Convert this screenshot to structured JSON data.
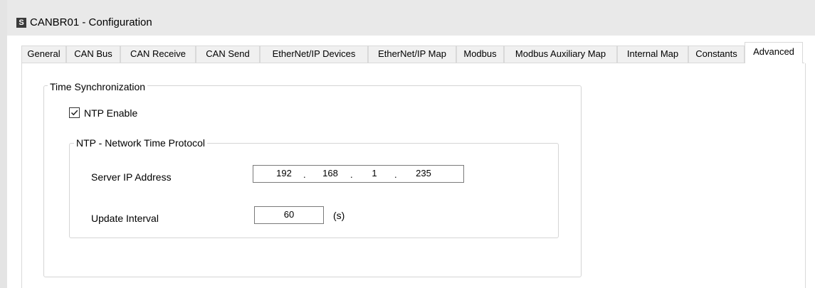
{
  "window": {
    "title": "CANBR01 - Configuration",
    "icon_letter": "S"
  },
  "tabs": [
    {
      "label": "General",
      "active": false
    },
    {
      "label": "CAN Bus",
      "active": false
    },
    {
      "label": "CAN Receive",
      "active": false
    },
    {
      "label": "CAN Send",
      "active": false
    },
    {
      "label": "EtherNet/IP Devices",
      "active": false
    },
    {
      "label": "EtherNet/IP Map",
      "active": false
    },
    {
      "label": "Modbus",
      "active": false
    },
    {
      "label": "Modbus Auxiliary Map",
      "active": false
    },
    {
      "label": "Internal Map",
      "active": false
    },
    {
      "label": "Constants",
      "active": false
    },
    {
      "label": "Advanced",
      "active": true
    }
  ],
  "time_sync": {
    "group_title": "Time Synchronization",
    "ntp_enable": {
      "label": "NTP Enable",
      "checked": true
    },
    "ntp_group": {
      "title": "NTP - Network Time Protocol",
      "server_ip": {
        "label": "Server IP Address",
        "octets": [
          "192",
          "168",
          "1",
          "235"
        ],
        "separator": "."
      },
      "update_interval": {
        "label": "Update Interval",
        "value": "60",
        "unit": "(s)"
      }
    }
  }
}
